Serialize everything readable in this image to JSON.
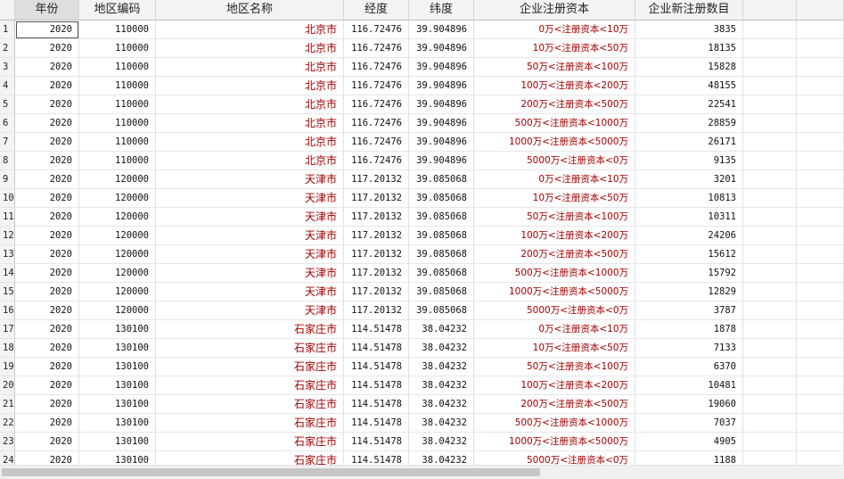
{
  "columns": [
    "",
    "年份",
    "地区编码",
    "地区名称",
    "经度",
    "纬度",
    "企业注册资本",
    "企业新注册数目",
    "",
    ""
  ],
  "rows": [
    [
      "1",
      "2020",
      "110000",
      "北京市",
      "116.72476",
      "39.904896",
      "0万<注册资本<10万",
      "3835"
    ],
    [
      "2",
      "2020",
      "110000",
      "北京市",
      "116.72476",
      "39.904896",
      "10万<注册资本<50万",
      "18135"
    ],
    [
      "3",
      "2020",
      "110000",
      "北京市",
      "116.72476",
      "39.904896",
      "50万<注册资本<100万",
      "15828"
    ],
    [
      "4",
      "2020",
      "110000",
      "北京市",
      "116.72476",
      "39.904896",
      "100万<注册资本<200万",
      "48155"
    ],
    [
      "5",
      "2020",
      "110000",
      "北京市",
      "116.72476",
      "39.904896",
      "200万<注册资本<500万",
      "22541"
    ],
    [
      "6",
      "2020",
      "110000",
      "北京市",
      "116.72476",
      "39.904896",
      "500万<注册资本<1000万",
      "28859"
    ],
    [
      "7",
      "2020",
      "110000",
      "北京市",
      "116.72476",
      "39.904896",
      "1000万<注册资本<5000万",
      "26171"
    ],
    [
      "8",
      "2020",
      "110000",
      "北京市",
      "116.72476",
      "39.904896",
      "5000万<注册资本<0万",
      "9135"
    ],
    [
      "9",
      "2020",
      "120000",
      "天津市",
      "117.20132",
      "39.085068",
      "0万<注册资本<10万",
      "3201"
    ],
    [
      "10",
      "2020",
      "120000",
      "天津市",
      "117.20132",
      "39.085068",
      "10万<注册资本<50万",
      "10813"
    ],
    [
      "11",
      "2020",
      "120000",
      "天津市",
      "117.20132",
      "39.085068",
      "50万<注册资本<100万",
      "10311"
    ],
    [
      "12",
      "2020",
      "120000",
      "天津市",
      "117.20132",
      "39.085068",
      "100万<注册资本<200万",
      "24206"
    ],
    [
      "13",
      "2020",
      "120000",
      "天津市",
      "117.20132",
      "39.085068",
      "200万<注册资本<500万",
      "15612"
    ],
    [
      "14",
      "2020",
      "120000",
      "天津市",
      "117.20132",
      "39.085068",
      "500万<注册资本<1000万",
      "15792"
    ],
    [
      "15",
      "2020",
      "120000",
      "天津市",
      "117.20132",
      "39.085068",
      "1000万<注册资本<5000万",
      "12829"
    ],
    [
      "16",
      "2020",
      "120000",
      "天津市",
      "117.20132",
      "39.085068",
      "5000万<注册资本<0万",
      "3787"
    ],
    [
      "17",
      "2020",
      "130100",
      "石家庄市",
      "114.51478",
      "38.04232",
      "0万<注册资本<10万",
      "1878"
    ],
    [
      "18",
      "2020",
      "130100",
      "石家庄市",
      "114.51478",
      "38.04232",
      "10万<注册资本<50万",
      "7133"
    ],
    [
      "19",
      "2020",
      "130100",
      "石家庄市",
      "114.51478",
      "38.04232",
      "50万<注册资本<100万",
      "6370"
    ],
    [
      "20",
      "2020",
      "130100",
      "石家庄市",
      "114.51478",
      "38.04232",
      "100万<注册资本<200万",
      "10481"
    ],
    [
      "21",
      "2020",
      "130100",
      "石家庄市",
      "114.51478",
      "38.04232",
      "200万<注册资本<500万",
      "19060"
    ],
    [
      "22",
      "2020",
      "130100",
      "石家庄市",
      "114.51478",
      "38.04232",
      "500万<注册资本<1000万",
      "7037"
    ],
    [
      "23",
      "2020",
      "130100",
      "石家庄市",
      "114.51478",
      "38.04232",
      "1000万<注册资本<5000万",
      "4905"
    ],
    [
      "24",
      "2020",
      "130100",
      "石家庄市",
      "114.51478",
      "38.04232",
      "5000万<注册资本<0万",
      "1188"
    ]
  ],
  "focused_cell": {
    "row": 1,
    "column": "年份"
  },
  "colors": {
    "string_text": "#a00000",
    "header_bg": "#f3f3f3",
    "grid_line": "#e0e0e0"
  }
}
